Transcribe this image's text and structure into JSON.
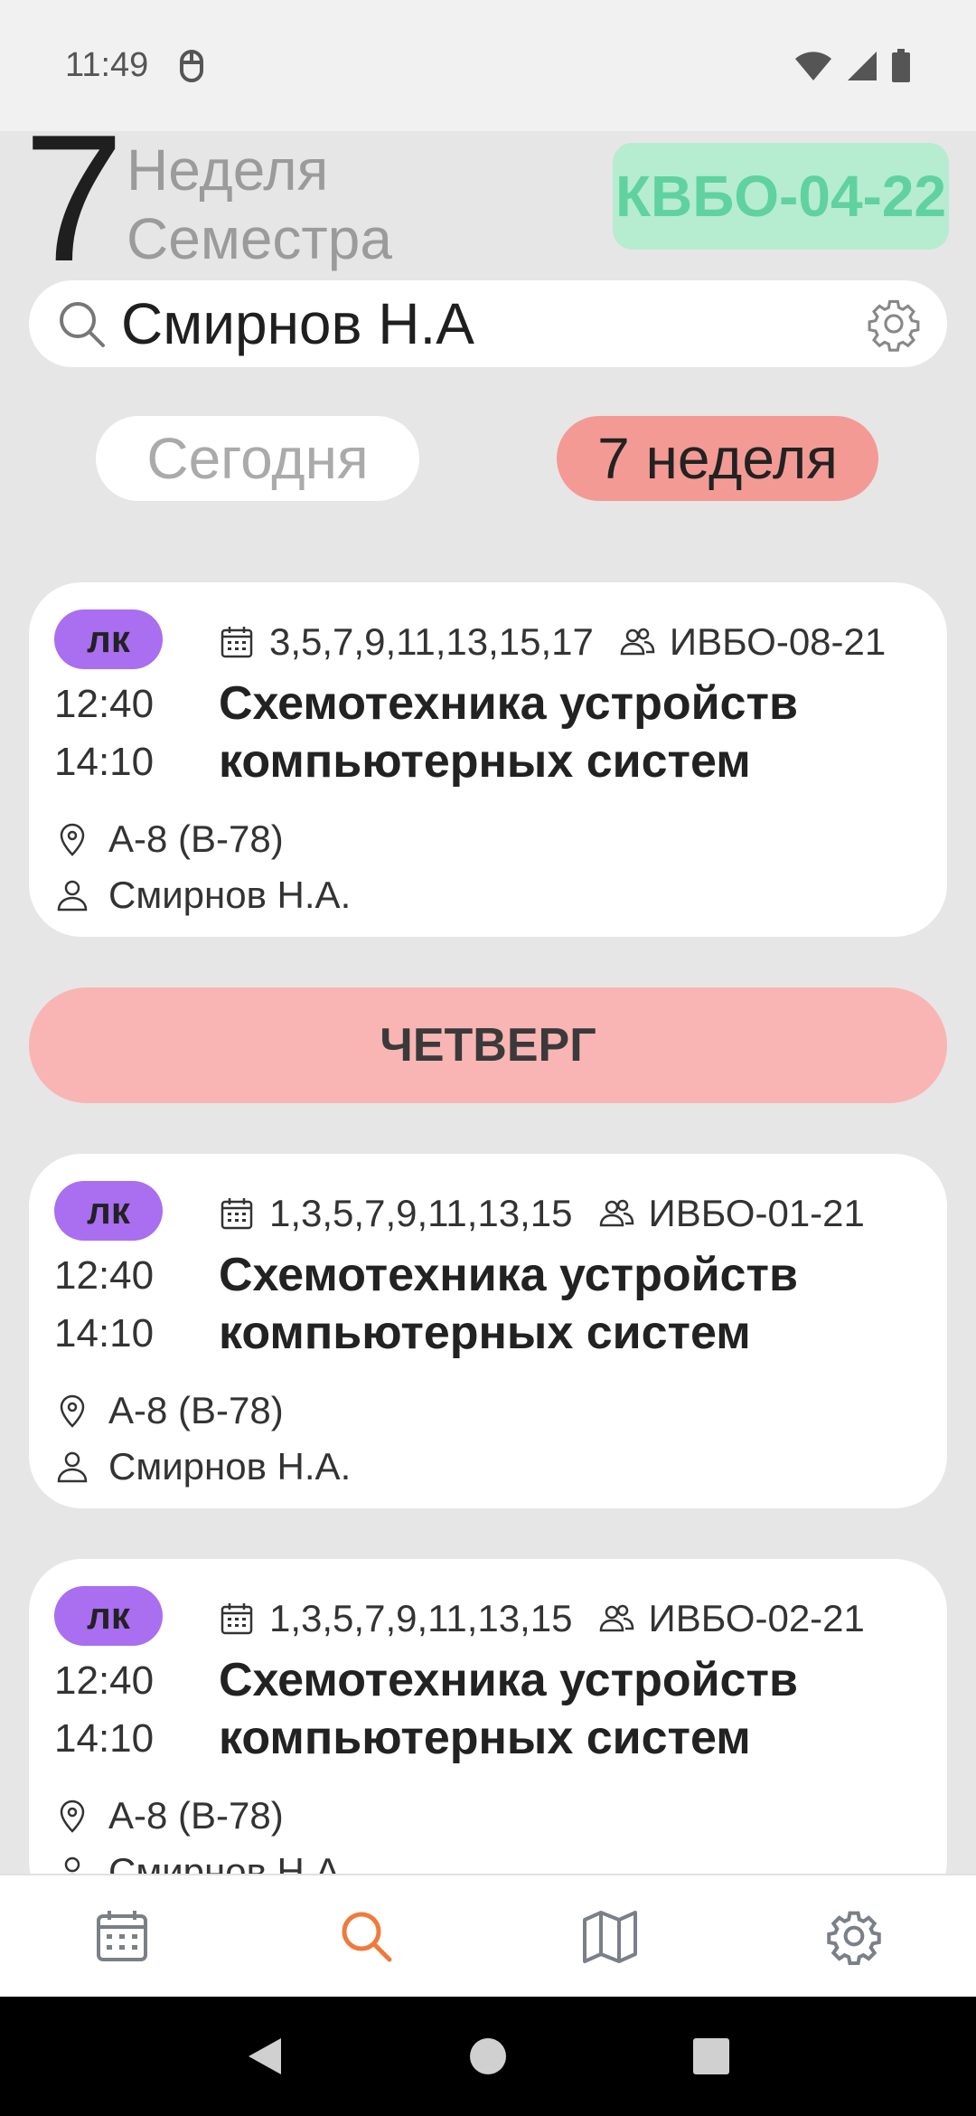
{
  "status_bar": {
    "time": "11:49"
  },
  "header": {
    "week_number": "7",
    "week_caption_line1": "Неделя",
    "week_caption_line2": "Семестра",
    "group": "КВБО-04-22"
  },
  "search": {
    "value": "Смирнов Н.А"
  },
  "toggles": {
    "today_label": "Сегодня",
    "week_label": "7 неделя"
  },
  "lessons": [
    {
      "type": "лк",
      "weeks": "3,5,7,9,11,13,15,17",
      "group": "ИВБО-08-21",
      "start": "12:40",
      "end": "14:10",
      "subject_line1": "Схемотехника устройств",
      "subject_line2": "компьютерных систем",
      "room": "А-8 (В-78)",
      "teacher": "Смирнов Н.А."
    },
    {
      "type": "лк",
      "weeks": "1,3,5,7,9,11,13,15",
      "group": "ИВБО-01-21",
      "start": "12:40",
      "end": "14:10",
      "subject_line1": "Схемотехника устройств",
      "subject_line2": "компьютерных систем",
      "room": "А-8 (В-78)",
      "teacher": "Смирнов Н.А."
    },
    {
      "type": "лк",
      "weeks": "1,3,5,7,9,11,13,15",
      "group": "ИВБО-02-21",
      "start": "12:40",
      "end": "14:10",
      "subject_line1": "Схемотехника устройств",
      "subject_line2": "компьютерных систем",
      "room": "А-8 (В-78)",
      "teacher": "Смирнов Н.А."
    }
  ],
  "day_header": "ЧЕТВЕРГ",
  "bottom_nav": {
    "items": [
      {
        "icon": "calendar-icon",
        "active": false
      },
      {
        "icon": "search-icon",
        "active": true
      },
      {
        "icon": "map-icon",
        "active": false
      },
      {
        "icon": "settings-icon",
        "active": false
      }
    ]
  },
  "colors": {
    "group_badge_bg": "#b6ecd0",
    "group_badge_text": "#5fd29f",
    "week_toggle_bg": "#f49a94",
    "day_header_bg": "#f9b5b3",
    "lesson_type_bg": "#aa6ef0",
    "nav_active": "#f07a3c",
    "nav_inactive": "#7a7f88"
  }
}
